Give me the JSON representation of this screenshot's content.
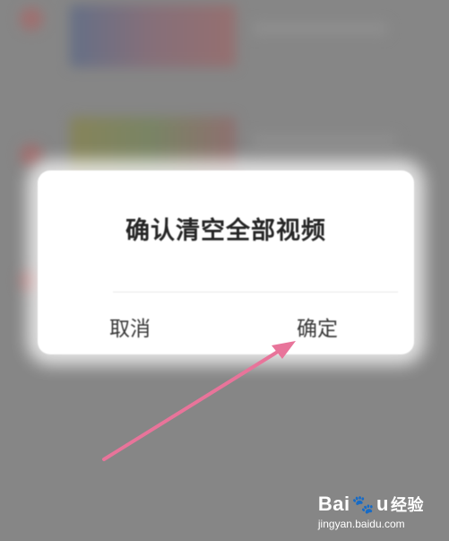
{
  "dialog": {
    "title": "确认清空全部视频",
    "cancel_label": "取消",
    "confirm_label": "确定"
  },
  "watermark": {
    "logo_latin": "Bai",
    "logo_paw": "🐾",
    "logo_latin_2": "u",
    "logo_cn": "经验",
    "url": "jingyan.baidu.com"
  },
  "annotation": {
    "arrow_color": "#e8749a"
  },
  "colors": {
    "background_dim": "#8e8e8e",
    "dialog_bg": "#ffffff",
    "title_text": "#262626"
  }
}
